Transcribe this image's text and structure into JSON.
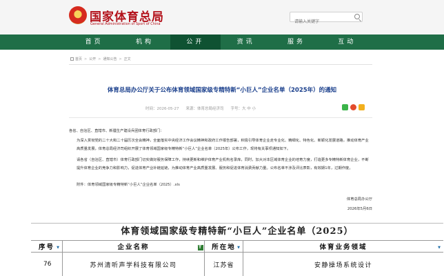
{
  "header": {
    "site_title": "国家体育总局",
    "site_subtitle": "General Administration of Sport of China",
    "search_placeholder": "请输入关键字"
  },
  "nav": {
    "items": [
      {
        "label": "首页"
      },
      {
        "label": "机构"
      },
      {
        "label": "公开",
        "active": true
      },
      {
        "label": "资讯"
      },
      {
        "label": "服务"
      },
      {
        "label": "互动"
      }
    ]
  },
  "breadcrumb": [
    "首页",
    "公开",
    "通知公告",
    "正文"
  ],
  "article": {
    "title": "体育总局办公厅关于公布体育领域国家级专精特新“小巨人”企业名单（2025年）的通知",
    "date": "时间：2026-05-27",
    "source": "来源：体育总局经济司",
    "font_size": "字号：大 中 小",
    "paragraphs": [
      "各省、自治区、直辖市、新疆生产建设兵团体育行政部门：",
      "为深入贯彻党的二十大和二十届历次全会精神，全面落实中央经济工作会议精神和政府工作报告部署，积极引导体育企业走专业化、精细化、特色化、新颖化发展道路，推动体育产业高质量发展，体育总局经济司组织开展了体育领域国家级专精特新“小巨人”企业名单（2025年）公布工作，现将有关事项通知如下。",
      "请各省（自治区、直辖市）体育行政部门切实做好服务保障工作，持续更新和维护体育产业机构名录库，同时，加大对本区域体育企业的培育力度，打造更多专精特新体育企业，不断提升体育企业的竞争力和影响力，促进体育产业补链延链，为推动体育产业高质量发展、服务和促进体育消费贡献力量。公布名单不涉及评比表彰，有效期1年，过期作废。",
      "附件：体育领域国家级专精特新“小巨人”企业名单（2025）.xls"
    ],
    "signature": "体育总局办公厅",
    "signature_date": "2026年5月6日"
  },
  "sheet": {
    "title": "体育领域国家级专精特新“小巨人”企业名单（2025）",
    "headers": [
      "序号",
      "企业名称",
      "所在地",
      "体育业务领域"
    ],
    "rows": [
      [
        "76",
        "苏州清听声学科技有限公司",
        "江苏省",
        "安静操场系统设计"
      ]
    ]
  },
  "colors": {
    "brand_red": "#b3121b",
    "nav_green": "#1f6e47",
    "nav_active": "#0f5232",
    "title_blue": "#1a3f8c"
  }
}
